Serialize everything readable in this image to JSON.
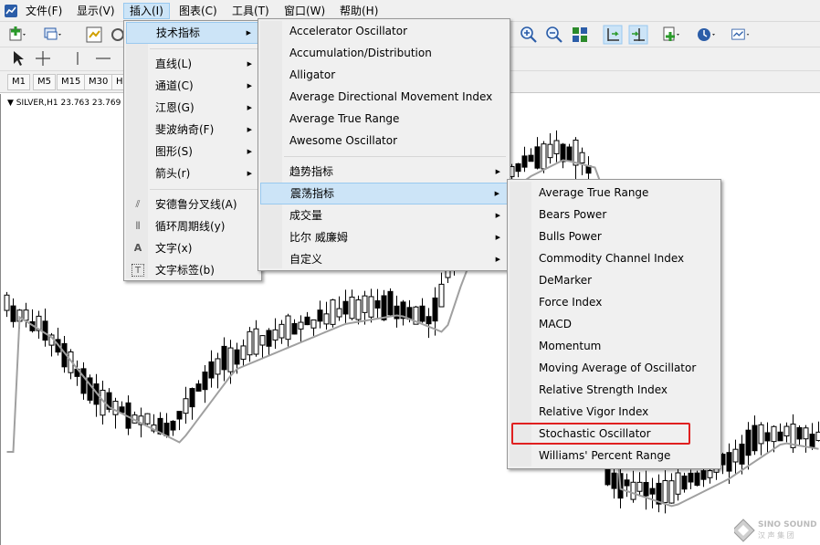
{
  "menubar": {
    "items": [
      "文件(F)",
      "显示(V)",
      "插入(I)",
      "图表(C)",
      "工具(T)",
      "窗口(W)",
      "帮助(H)"
    ]
  },
  "timeframes": [
    "M1",
    "M5",
    "M15",
    "M30",
    "H"
  ],
  "chart": {
    "symbol_label": "SILVER,H1  23.763 23.769"
  },
  "insert_menu": {
    "items": [
      {
        "label": "技术指标",
        "submenu": true
      },
      {
        "label": "直线(L)",
        "submenu": true
      },
      {
        "label": "通道(C)",
        "submenu": true
      },
      {
        "label": "江恩(G)",
        "submenu": true
      },
      {
        "label": "斐波纳奇(F)",
        "submenu": true
      },
      {
        "label": "图形(S)",
        "submenu": true
      },
      {
        "label": "箭头(r)",
        "submenu": true
      },
      {
        "label": "安德鲁分叉线(A)",
        "icon": "pitchfork-icon"
      },
      {
        "label": "循环周期线(y)",
        "icon": "cycle-lines-icon"
      },
      {
        "label": "文字(x)",
        "icon": "text-icon"
      },
      {
        "label": "文字标签(b)",
        "icon": "text-label-icon"
      }
    ]
  },
  "indicators_menu": {
    "items": [
      "Accelerator Oscillator",
      "Accumulation/Distribution",
      "Alligator",
      "Average Directional Movement Index",
      "Average True Range",
      "Awesome Oscillator"
    ],
    "groups": [
      "趋势指标",
      "震荡指标",
      "成交量",
      "比尔 威廉姆",
      "自定义"
    ]
  },
  "oscillators_menu": {
    "items": [
      "Average True Range",
      "Bears Power",
      "Bulls Power",
      "Commodity Channel Index",
      "DeMarker",
      "Force Index",
      "MACD",
      "Momentum",
      "Moving Average of Oscillator",
      "Relative Strength Index",
      "Relative Vigor Index",
      "Stochastic Oscillator",
      "Williams' Percent Range"
    ],
    "highlighted": "Stochastic Oscillator"
  },
  "watermark": {
    "brand": "SINO SOUND",
    "sub": "汉 声 集 团"
  },
  "colors": {
    "menu_highlight": "#cce4f7",
    "highlight_box": "#e02020"
  }
}
